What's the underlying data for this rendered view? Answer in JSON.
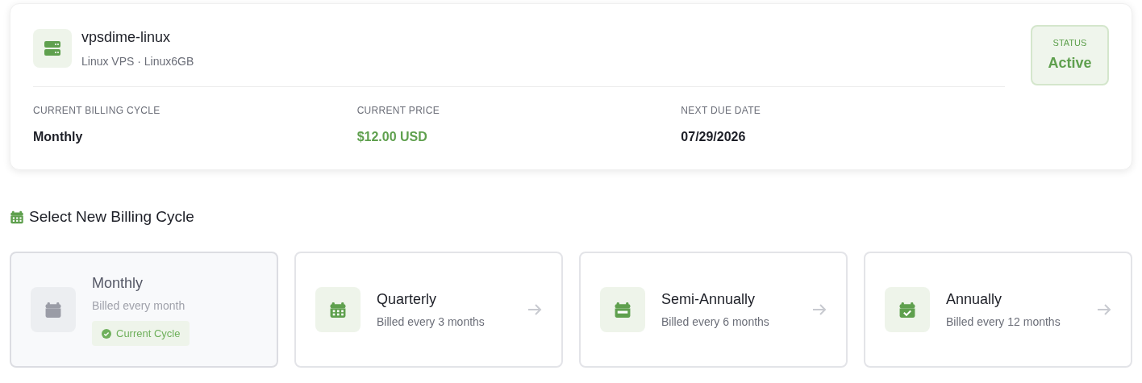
{
  "service": {
    "name": "vpsdime-linux",
    "subtitle": "Linux VPS · Linux6GB",
    "status": {
      "label": "STATUS",
      "value": "Active"
    },
    "stats": [
      {
        "label": "CURRENT BILLING CYCLE",
        "value": "Monthly",
        "kind": "plain"
      },
      {
        "label": "CURRENT PRICE",
        "value": "$12.00 USD",
        "kind": "price"
      },
      {
        "label": "NEXT DUE DATE",
        "value": "07/29/2026",
        "kind": "plain"
      }
    ]
  },
  "section_title": "Select New Billing Cycle",
  "cycles": [
    {
      "name": "Monthly",
      "description": "Billed every month",
      "kind": "month",
      "current": true,
      "badge": "Current Cycle"
    },
    {
      "name": "Quarterly",
      "description": "Billed every 3 months",
      "kind": "quarter",
      "current": false
    },
    {
      "name": "Semi-Annually",
      "description": "Billed every 6 months",
      "kind": "semi",
      "current": false
    },
    {
      "name": "Annually",
      "description": "Billed every 12 months",
      "kind": "annual",
      "current": false
    }
  ]
}
